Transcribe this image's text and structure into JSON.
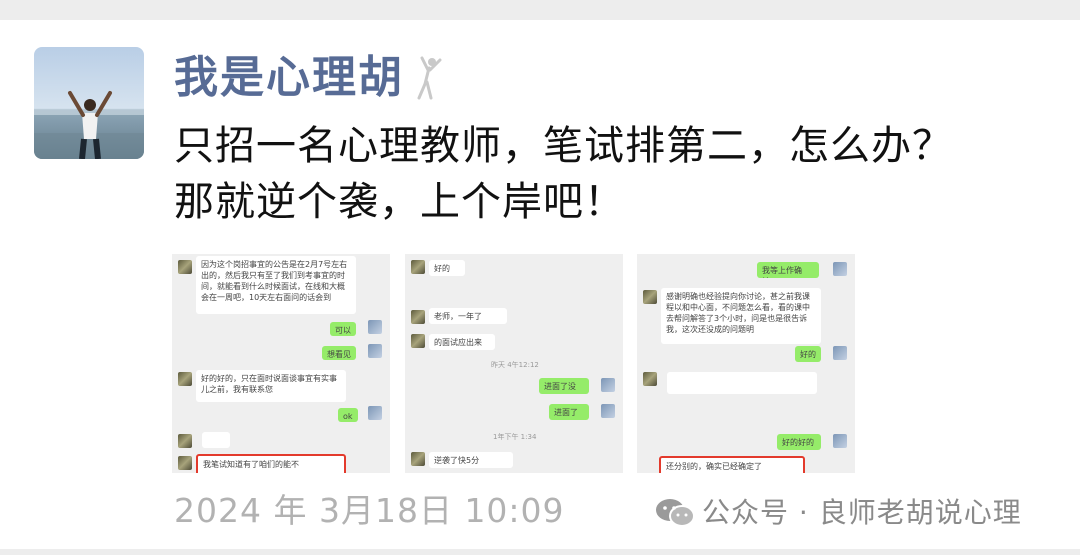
{
  "post": {
    "nickname": "我是心理胡",
    "text": "只招一名心理教师，笔试排第二，怎么办？\n那就逆个袭，上个岸吧！",
    "timestamp": "2024 年 3月18日 10:09"
  },
  "watermark": {
    "text": "公众号 · 良师老胡说心理"
  },
  "thumbnails": [
    {
      "messages": [
        "因为这个岗招事宜的公告是在2月7号左右出的，然后我只有至了我们到考事宜的时间，就能看到什么时候面试，在线和大概会在一周吧，10天左右面问的话会到",
        "可以",
        "想看见",
        "好的好的，只在面时说面谈事宜有实事儿之前，我有联系您",
        "ok",
        "我笔试知道有了咱们的能不"
      ]
    },
    {
      "messages": [
        "好的",
        "老师，一年了",
        "的面试应出来",
        "昨天 4午12:12",
        "进面了没",
        "进面了",
        "1年下午 1:34",
        "逆袭了快5分"
      ]
    },
    {
      "messages": [
        "我等上作确认。",
        "感谢明确也经验提向你讨论，甚之前我课程以和中心面，不问题怎么看，看的课中去帮问解答了3个小时，问是也是很告诉我，这次还没成的问题明",
        "好的",
        "好的好的",
        "还分别的，确实已经确定了"
      ]
    }
  ]
}
